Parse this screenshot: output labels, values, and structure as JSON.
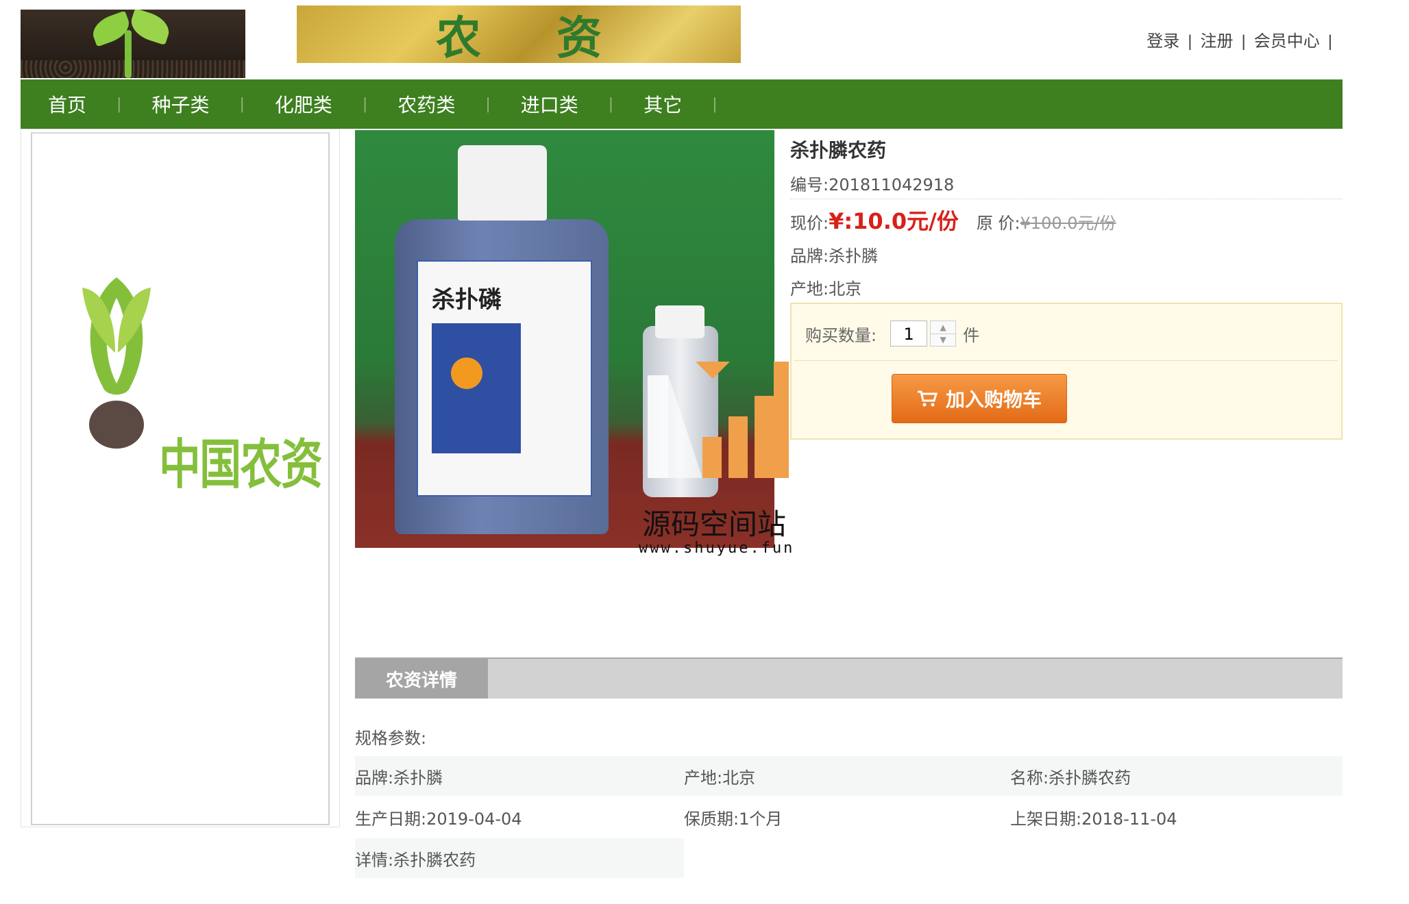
{
  "header": {
    "banner_text": "农资",
    "links": [
      "登录",
      "注册",
      "会员中心"
    ],
    "separator": "|"
  },
  "nav": {
    "items": [
      "首页",
      "种子类",
      "化肥类",
      "农药类",
      "进口类",
      "其它"
    ],
    "separator": "|"
  },
  "sidebar": {
    "brand_text": "中国农资",
    "colors": {
      "green": "#84bf3b",
      "brown": "#5b4a44"
    }
  },
  "product_image": {
    "label_title": "杀扑磷",
    "alt": "bottle-image"
  },
  "watermark": {
    "text": "源码空间站",
    "url": "www.shuyue.fun"
  },
  "product": {
    "title": "杀扑膦农药",
    "code": "编号:201811042918",
    "price_label": "现价:",
    "price_now": "¥:10.0元/份",
    "orig_label": "原 价:",
    "price_orig": "¥100.0元/份",
    "brand": "品牌:杀扑膦",
    "origin": "产地:北京"
  },
  "buy": {
    "qty_label": "购买数量:",
    "qty_value": "1",
    "unit": "件",
    "cart_button": "加入购物车"
  },
  "details": {
    "tab": "农资详情",
    "spec_title": "规格参数:",
    "row1": [
      "品牌:杀扑膦",
      "产地:北京",
      "名称:杀扑膦农药"
    ],
    "row2": [
      "生产日期:2019-04-04",
      "保质期:1个月",
      "上架日期:2018-11-04"
    ],
    "row3": [
      "详情:杀扑膦农药"
    ]
  },
  "colors": {
    "nav_bg": "#3e7f20",
    "price_red": "#d9201a",
    "cart_orange": "#e46a17",
    "buybox_bg": "#fffbe8"
  }
}
